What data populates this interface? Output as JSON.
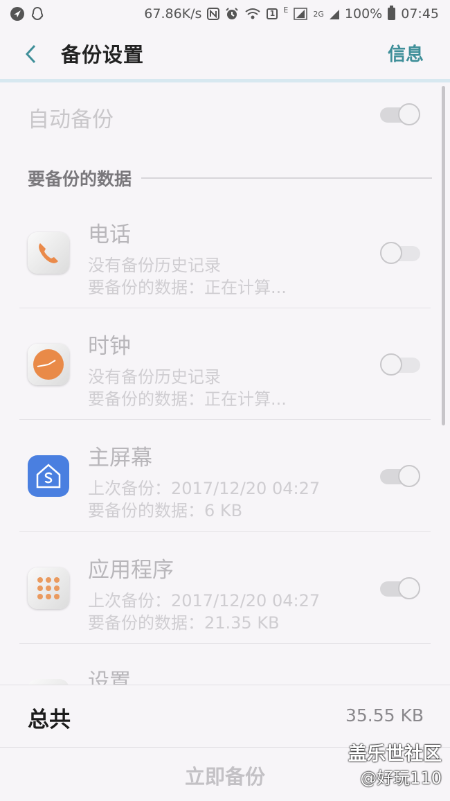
{
  "status_bar": {
    "speed": "67.86K/s",
    "sim_badge": "1",
    "network_e": "E",
    "network_2g": "2G",
    "battery": "100%",
    "time": "07:45"
  },
  "header": {
    "title": "备份设置",
    "info": "信息"
  },
  "auto_backup": {
    "label": "自动备份",
    "enabled": true
  },
  "section": {
    "title": "要备份的数据"
  },
  "apps": [
    {
      "name": "电话",
      "line1": "没有备份历史记录",
      "line2": "要备份的数据：正在计算...",
      "enabled": false,
      "icon": "phone-icon"
    },
    {
      "name": "时钟",
      "line1": "没有备份历史记录",
      "line2": "要备份的数据：正在计算...",
      "enabled": false,
      "icon": "clock-icon"
    },
    {
      "name": "主屏幕",
      "line1": "上次备份：2017/12/20 04:27",
      "line2": "要备份的数据：6 KB",
      "enabled": true,
      "icon": "home-screen-icon"
    },
    {
      "name": "应用程序",
      "line1": "上次备份：2017/12/20 04:27",
      "line2": "要备份的数据：21.35 KB",
      "enabled": true,
      "icon": "apps-grid-icon"
    },
    {
      "name": "设置",
      "line1": "",
      "line2": "",
      "enabled": true,
      "icon": "settings-icon"
    }
  ],
  "footer": {
    "total_label": "总共",
    "total_value": "35.55 KB",
    "backup_now": "立即备份"
  },
  "watermark": {
    "line1": "盖乐世社区",
    "line2": "@好玩110"
  },
  "colors": {
    "accent": "#3f8f99",
    "background": "#f7f5f8",
    "disabled_text": "#c9c7ca"
  }
}
